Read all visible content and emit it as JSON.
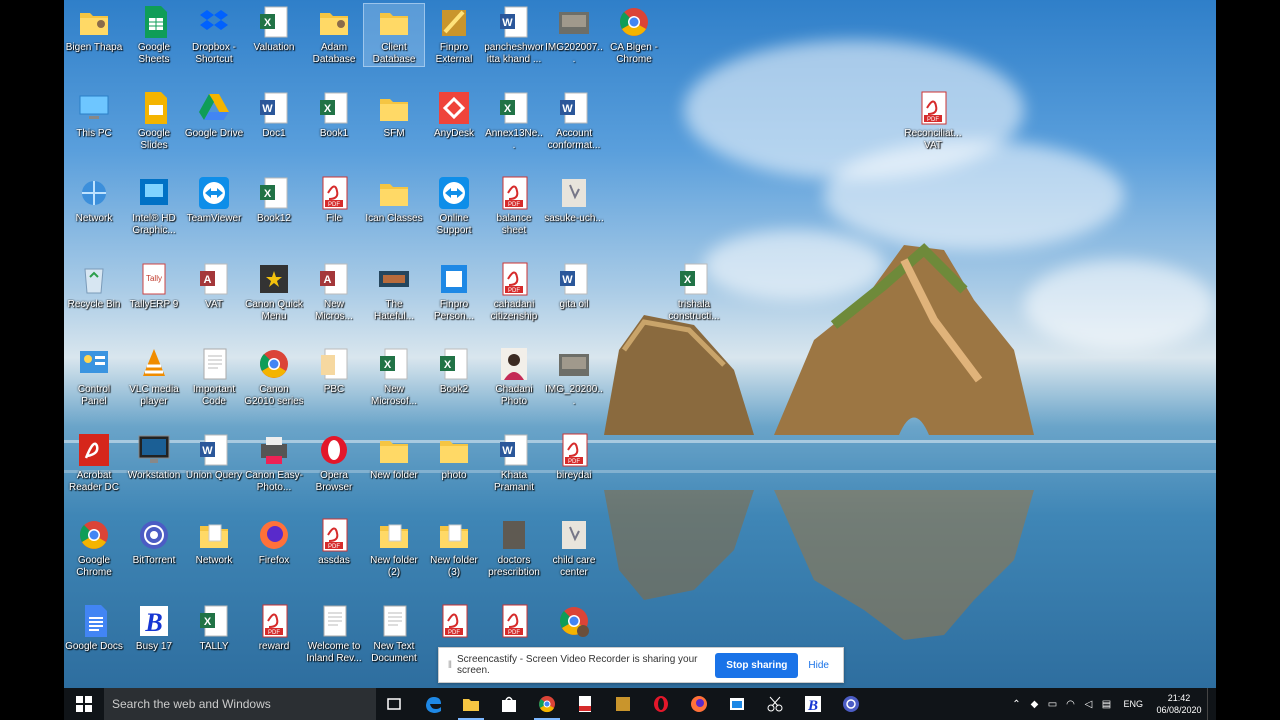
{
  "desktop": {
    "icons": [
      {
        "label": "Bigen Thapa",
        "type": "user-folder"
      },
      {
        "label": "Google Sheets",
        "type": "google-sheets"
      },
      {
        "label": "Dropbox - Shortcut",
        "type": "dropbox"
      },
      {
        "label": "Valuation",
        "type": "excel"
      },
      {
        "label": "Adam Database",
        "type": "user-folder"
      },
      {
        "label": "Client Database",
        "type": "folder",
        "selected": true
      },
      {
        "label": "Finpro External Da...",
        "type": "finpro"
      },
      {
        "label": "pancheshwor itta khand ...",
        "type": "word"
      },
      {
        "label": "IMG202007...",
        "type": "photo"
      },
      {
        "label": "CA Bigen - Chrome",
        "type": "chrome"
      },
      {
        "label": "This PC",
        "type": "this-pc"
      },
      {
        "label": "Google Slides",
        "type": "google-slides"
      },
      {
        "label": "Google Drive",
        "type": "google-drive"
      },
      {
        "label": "Doc1",
        "type": "word"
      },
      {
        "label": "Book1",
        "type": "excel"
      },
      {
        "label": "SFM",
        "type": "folder"
      },
      {
        "label": "AnyDesk",
        "type": "anydesk"
      },
      {
        "label": "Annex13Ne...",
        "type": "excel"
      },
      {
        "label": "Account conformat...",
        "type": "word"
      },
      {
        "label": "Reconciliat... VAT",
        "type": "pdf"
      },
      {
        "label": "Network",
        "type": "network"
      },
      {
        "label": "Intel® HD Graphic...",
        "type": "intel"
      },
      {
        "label": "TeamViewer",
        "type": "teamviewer"
      },
      {
        "label": "Book12",
        "type": "excel"
      },
      {
        "label": "File",
        "type": "pdf"
      },
      {
        "label": "Ican Classes",
        "type": "folder"
      },
      {
        "label": "Online Support",
        "type": "teamviewer"
      },
      {
        "label": "balance sheet",
        "type": "pdf"
      },
      {
        "label": "sasuke-uch...",
        "type": "photo-light"
      },
      {
        "label": "Recycle Bin",
        "type": "recycle"
      },
      {
        "label": "TallyERP 9",
        "type": "tally"
      },
      {
        "label": "VAT",
        "type": "access"
      },
      {
        "label": "Canon Quick Menu",
        "type": "canon"
      },
      {
        "label": "New Micros...",
        "type": "access"
      },
      {
        "label": "The Hateful...",
        "type": "video"
      },
      {
        "label": "Finpro Person...",
        "type": "finpro-blue"
      },
      {
        "label": "cahadani citizenship",
        "type": "pdf"
      },
      {
        "label": "gita oil",
        "type": "word"
      },
      {
        "label": "trishala constructi...",
        "type": "excel"
      },
      {
        "label": "Control Panel",
        "type": "control-panel"
      },
      {
        "label": "VLC media player",
        "type": "vlc"
      },
      {
        "label": "Important Code",
        "type": "text"
      },
      {
        "label": "Canon G2010 series Onlin...",
        "type": "chrome"
      },
      {
        "label": "PBC",
        "type": "access-light"
      },
      {
        "label": "New Microsof...",
        "type": "excel"
      },
      {
        "label": "Book2",
        "type": "excel"
      },
      {
        "label": "Chadani Photo",
        "type": "portrait"
      },
      {
        "label": "IMG_20200...",
        "type": "photo"
      },
      {
        "label": "Acrobat Reader DC",
        "type": "acrobat"
      },
      {
        "label": "Workstation",
        "type": "monitor"
      },
      {
        "label": "Union Query",
        "type": "word"
      },
      {
        "label": "Canon Easy-Photo...",
        "type": "canon-printer"
      },
      {
        "label": "Opera Browser",
        "type": "opera"
      },
      {
        "label": "New folder",
        "type": "folder"
      },
      {
        "label": "photo",
        "type": "folder"
      },
      {
        "label": "Khata Pramanit",
        "type": "word"
      },
      {
        "label": "bireydai",
        "type": "pdf"
      },
      {
        "label": "Google Chrome",
        "type": "chrome"
      },
      {
        "label": "BitTorrent",
        "type": "bittorrent"
      },
      {
        "label": "Network",
        "type": "folder-doc"
      },
      {
        "label": "Firefox",
        "type": "firefox"
      },
      {
        "label": "assdas",
        "type": "pdf"
      },
      {
        "label": "New folder (2)",
        "type": "folder-doc"
      },
      {
        "label": "New folder (3)",
        "type": "folder-doc"
      },
      {
        "label": "doctors prescribtion",
        "type": "photo-dark"
      },
      {
        "label": "child care center",
        "type": "photo-light"
      },
      {
        "label": "Google Docs",
        "type": "google-docs"
      },
      {
        "label": "Busy 17",
        "type": "busy"
      },
      {
        "label": "TALLY",
        "type": "excel"
      },
      {
        "label": "reward",
        "type": "pdf"
      },
      {
        "label": "Welcome to Inland Rev...",
        "type": "text"
      },
      {
        "label": "New Text Document",
        "type": "text"
      },
      {
        "label": "",
        "type": "pdf"
      },
      {
        "label": "",
        "type": "pdf"
      },
      {
        "label": "",
        "type": "chrome-avatar"
      }
    ]
  },
  "notification": {
    "message": "Screencastify - Screen Video Recorder is sharing your screen.",
    "stop_label": "Stop sharing",
    "hide_label": "Hide"
  },
  "taskbar": {
    "search_placeholder": "Search the web and Windows",
    "pinned": [
      {
        "name": "task-view",
        "icon": "task-view-icon"
      },
      {
        "name": "edge",
        "icon": "edge-icon"
      },
      {
        "name": "file-explorer",
        "icon": "folder-icon",
        "active": true
      },
      {
        "name": "store",
        "icon": "store-icon"
      },
      {
        "name": "chrome",
        "icon": "chrome-icon",
        "active": true
      },
      {
        "name": "pdf-app",
        "icon": "pdf-icon"
      },
      {
        "name": "finpro",
        "icon": "finpro-icon"
      },
      {
        "name": "opera",
        "icon": "opera-icon"
      },
      {
        "name": "firefox",
        "icon": "firefox-icon"
      },
      {
        "name": "app-window",
        "icon": "window-icon"
      },
      {
        "name": "snipping",
        "icon": "scissors-icon"
      },
      {
        "name": "busy",
        "icon": "busy-icon"
      },
      {
        "name": "vlc-like",
        "icon": "bittorrent-icon"
      }
    ],
    "language": "ENG",
    "time": "21:42",
    "date": "06/08/2020"
  },
  "colors": {
    "taskbar": "#101418",
    "accent": "#1a73e8"
  }
}
